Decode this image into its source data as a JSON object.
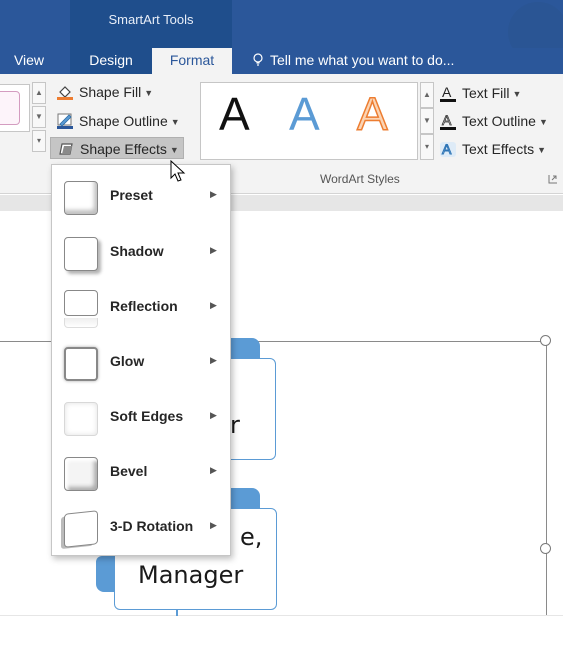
{
  "context_tab_group": "SmartArt Tools",
  "tabs": {
    "view": "View",
    "design": "Design",
    "format": "Format"
  },
  "tell_me": "Tell me what you want to do...",
  "shape_styles": {
    "fill": "Shape Fill",
    "outline": "Shape Outline",
    "effects": "Shape Effects"
  },
  "wordart": {
    "samples": [
      "A",
      "A",
      "A"
    ],
    "group_label": "WordArt Styles",
    "text_fill": "Text Fill",
    "text_outline": "Text Outline",
    "text_effects": "Text Effects"
  },
  "menu": {
    "items": [
      {
        "label": "Preset",
        "thumb": "preset"
      },
      {
        "label": "Shadow",
        "thumb": "shadow"
      },
      {
        "label": "Reflection",
        "thumb": "reflection"
      },
      {
        "label": "Glow",
        "thumb": "glow"
      },
      {
        "label": "Soft Edges",
        "thumb": "soft-edges"
      },
      {
        "label": "Bevel",
        "thumb": "bevel"
      },
      {
        "label": "3-D Rotation",
        "thumb": "3d-rotation"
      }
    ]
  },
  "canvas": {
    "node1_text": "r",
    "node2_line1": "e,",
    "node2_line2": "Manager"
  },
  "colors": {
    "ribbon_blue": "#2b579a",
    "accent_blue": "#5b9bd5",
    "wordart_orange": "#ed7d31"
  }
}
